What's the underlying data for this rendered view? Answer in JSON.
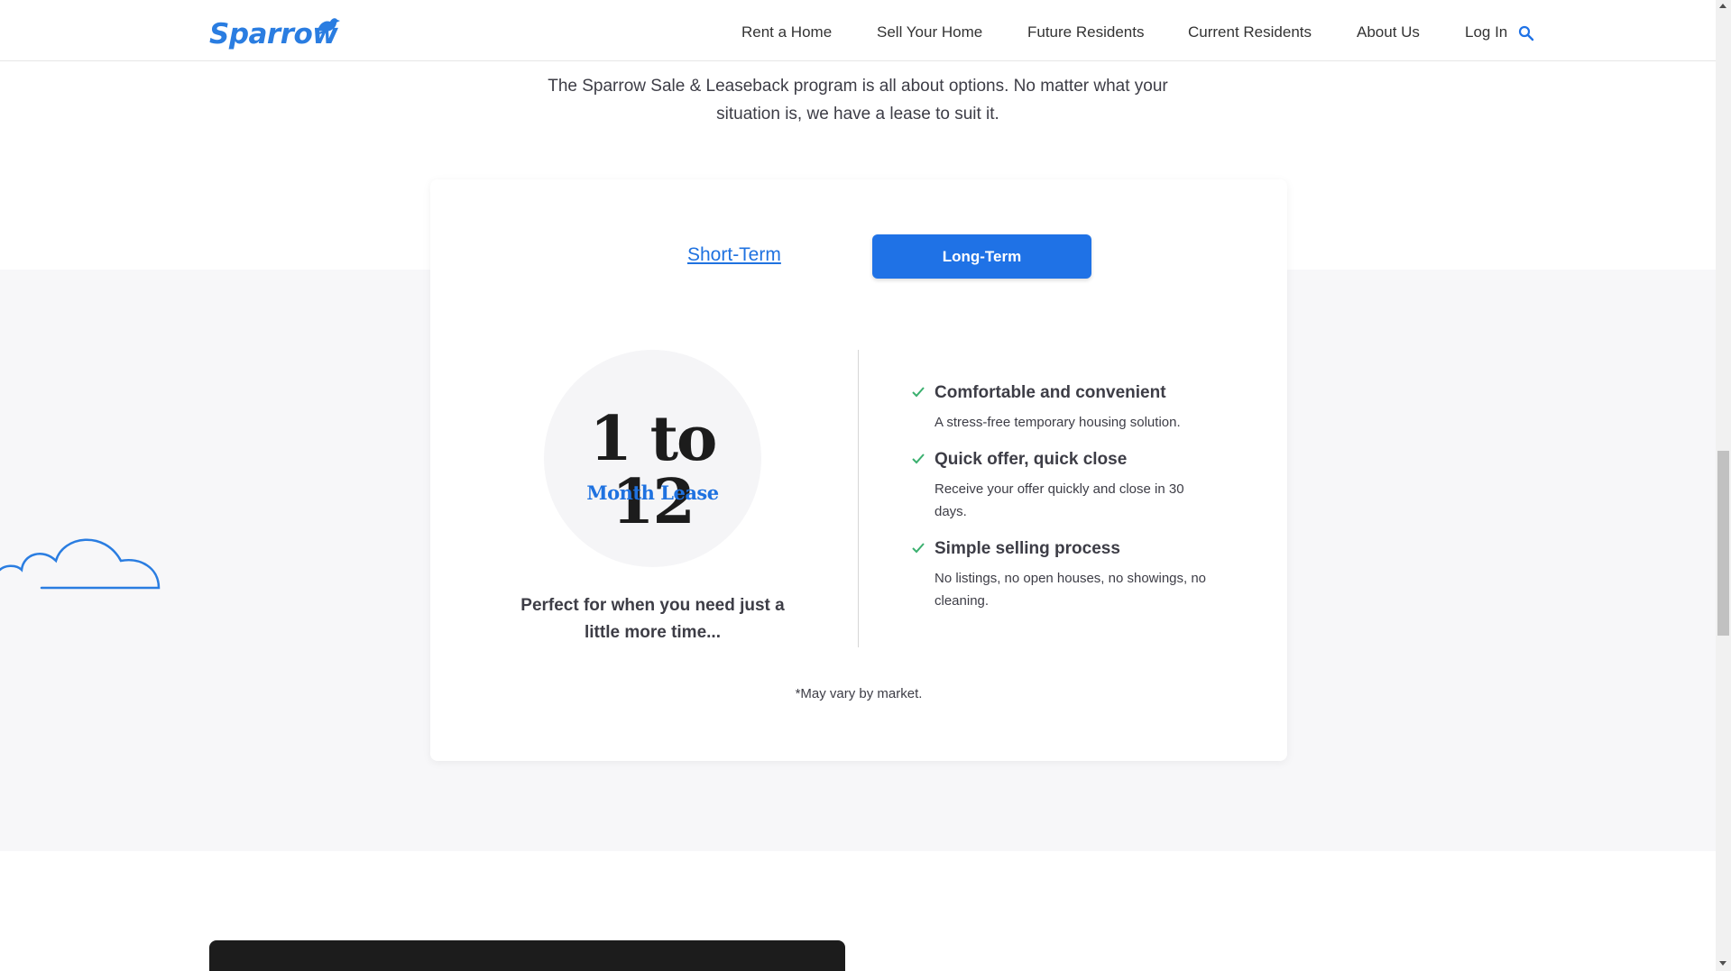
{
  "header": {
    "logo_text": "Sparrow",
    "nav": [
      {
        "label": "Rent a Home"
      },
      {
        "label": "Sell Your Home"
      },
      {
        "label": "Future Residents"
      },
      {
        "label": "Current Residents"
      },
      {
        "label": "About Us"
      },
      {
        "label": "Log In"
      }
    ],
    "search_icon": "search-icon"
  },
  "intro": {
    "text": "The Sparrow Sale & Leaseback program is all about options. No matter what your situation is, we have a lease to suit it."
  },
  "card": {
    "tabs": [
      {
        "label": "Short-Term",
        "active": false
      },
      {
        "label": "Long-Term",
        "active": true
      }
    ],
    "lease_range": "1 to 12",
    "lease_unit": "Month Lease",
    "tagline": "Perfect for when you need just a little more time...",
    "features": [
      {
        "icon": "check-icon",
        "title": "Comfortable and convenient",
        "description": "A stress-free temporary housing solution."
      },
      {
        "icon": "check-icon",
        "title": "Quick offer, quick close",
        "description": "Receive your offer quickly and close in 30 days."
      },
      {
        "icon": "check-icon",
        "title": "Simple selling process",
        "description": "No listings, no open houses, no showings, no cleaning."
      }
    ],
    "note": "*May vary by market."
  },
  "colors": {
    "brand_blue": "#1f72e6",
    "check_green": "#3bb06f",
    "band_grey": "#f7f7f9",
    "text_dark": "#3d3d46"
  }
}
